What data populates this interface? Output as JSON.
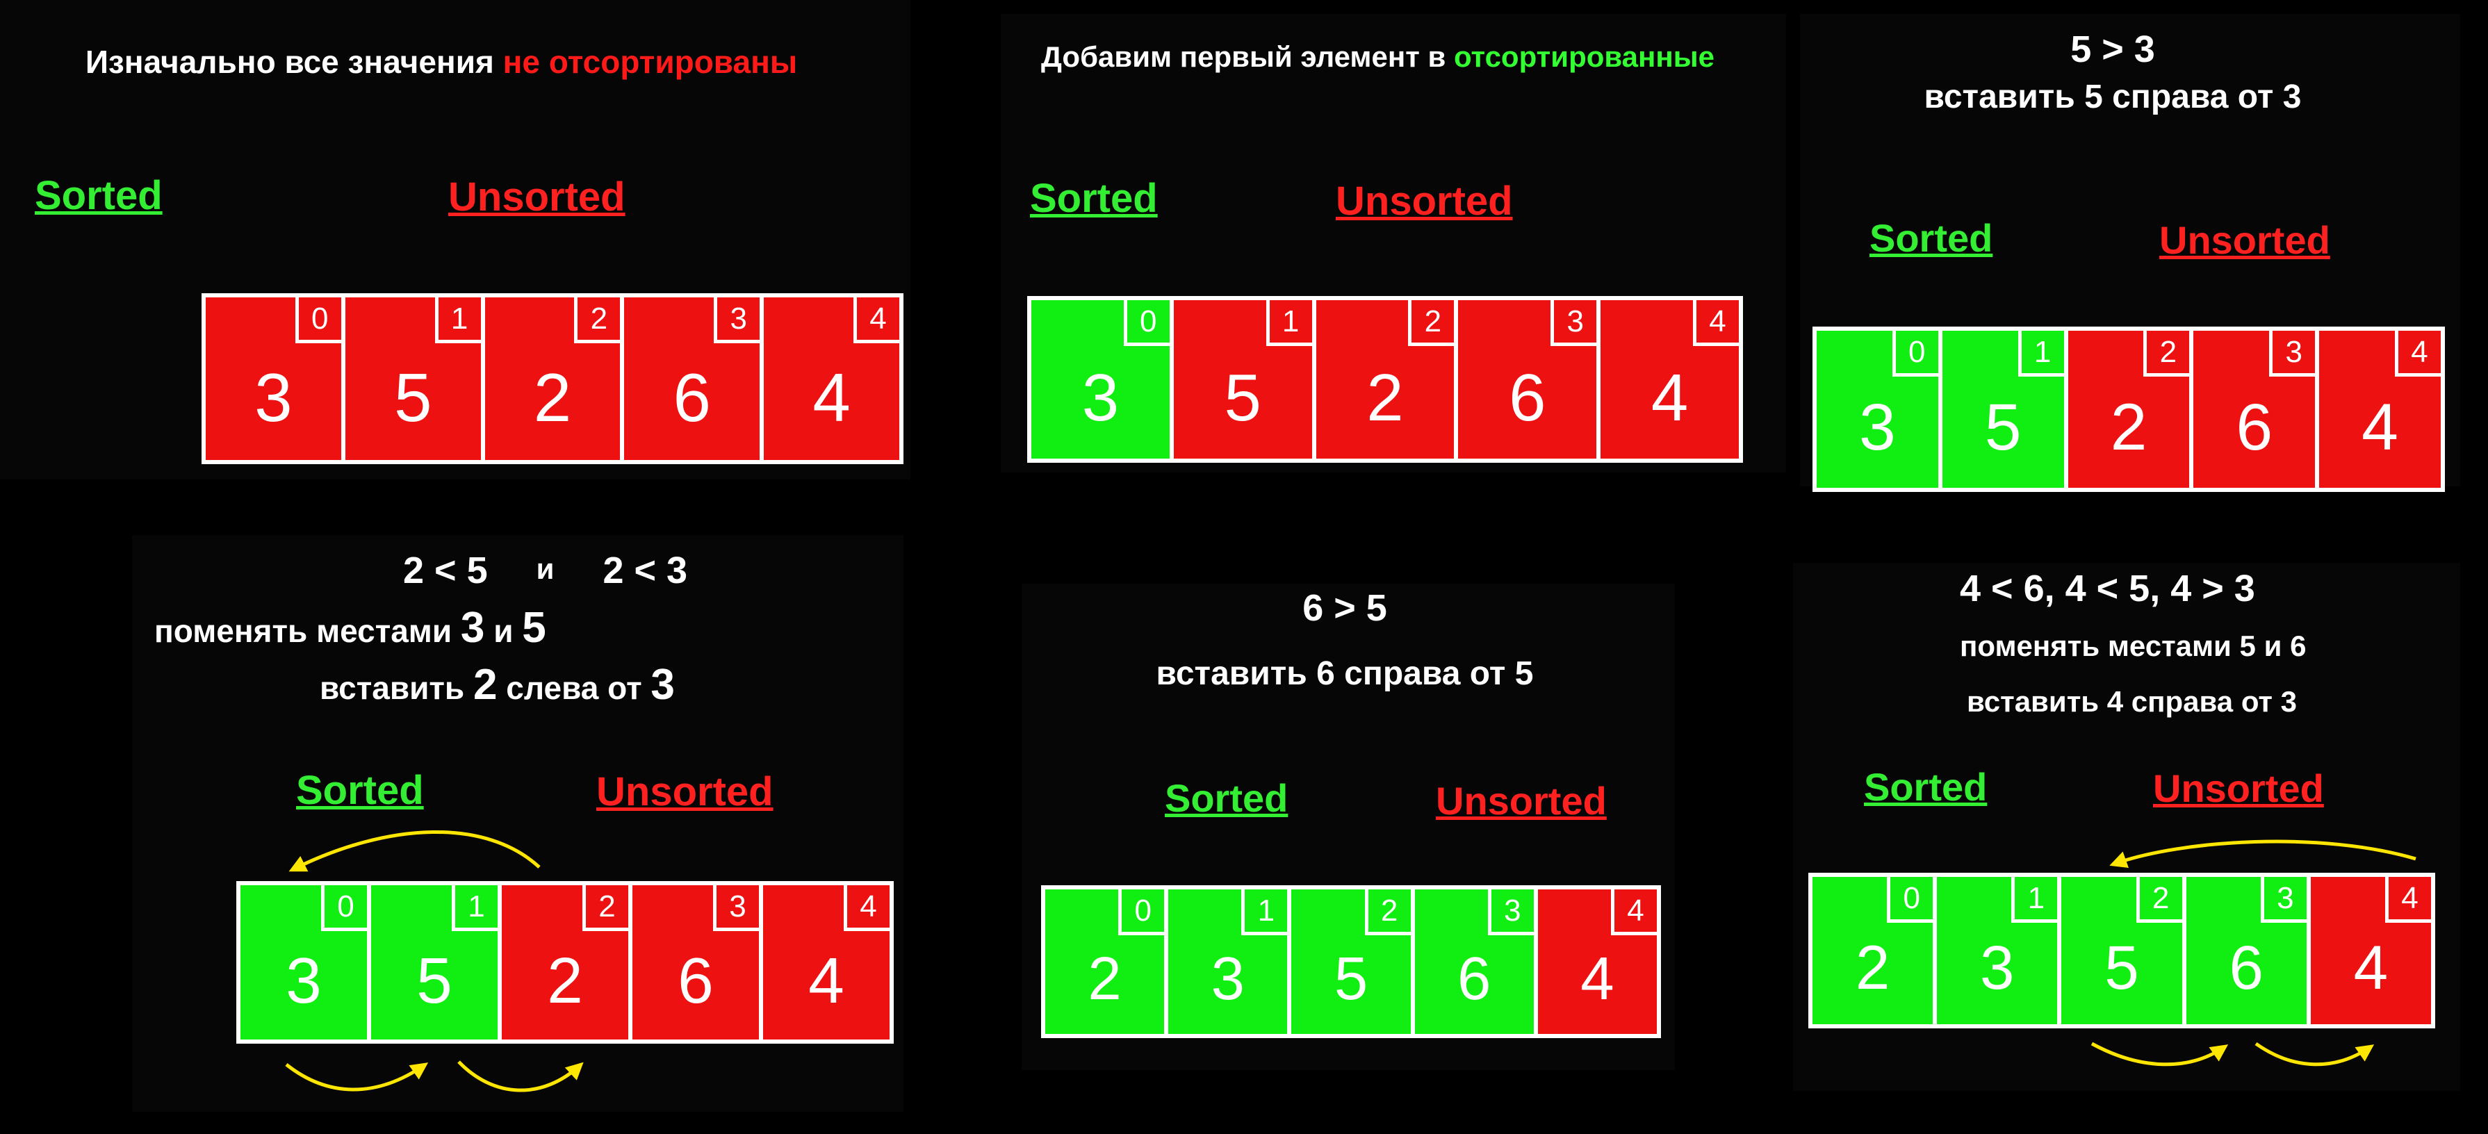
{
  "colors": {
    "sorted": "#11ee11",
    "unsorted": "#ee1111",
    "arrow": "#ffe600",
    "background": "#000000"
  },
  "labels": {
    "sorted": "Sorted",
    "unsorted": "Unsorted"
  },
  "panel1": {
    "caption_white": "Изначально все значения ",
    "caption_red": "не отсортированы",
    "cells": [
      {
        "value": "3",
        "index": "0",
        "state": "unsorted"
      },
      {
        "value": "5",
        "index": "1",
        "state": "unsorted"
      },
      {
        "value": "2",
        "index": "2",
        "state": "unsorted"
      },
      {
        "value": "6",
        "index": "3",
        "state": "unsorted"
      },
      {
        "value": "4",
        "index": "4",
        "state": "unsorted"
      }
    ]
  },
  "panel2": {
    "caption_white": "Добавим первый элемент в ",
    "caption_green": "отсортированные",
    "cells": [
      {
        "value": "3",
        "index": "0",
        "state": "sorted"
      },
      {
        "value": "5",
        "index": "1",
        "state": "unsorted"
      },
      {
        "value": "2",
        "index": "2",
        "state": "unsorted"
      },
      {
        "value": "6",
        "index": "3",
        "state": "unsorted"
      },
      {
        "value": "4",
        "index": "4",
        "state": "unsorted"
      }
    ]
  },
  "panel3": {
    "line1": "5 > 3",
    "line2": "вставить 5 справа от 3",
    "cells": [
      {
        "value": "3",
        "index": "0",
        "state": "sorted"
      },
      {
        "value": "5",
        "index": "1",
        "state": "sorted"
      },
      {
        "value": "2",
        "index": "2",
        "state": "unsorted"
      },
      {
        "value": "6",
        "index": "3",
        "state": "unsorted"
      },
      {
        "value": "4",
        "index": "4",
        "state": "unsorted"
      }
    ]
  },
  "panel4": {
    "line1_a": "2 < 5",
    "line1_b": "и",
    "line1_c": "2 < 3",
    "line2_a": "поменять местами ",
    "line2_b": "3",
    "line2_c": " и ",
    "line2_d": "5",
    "line3_a": "вставить ",
    "line3_b": "2",
    "line3_c": " слева от ",
    "line3_d": "3",
    "cells": [
      {
        "value": "3",
        "index": "0",
        "state": "sorted"
      },
      {
        "value": "5",
        "index": "1",
        "state": "sorted"
      },
      {
        "value": "2",
        "index": "2",
        "state": "unsorted"
      },
      {
        "value": "6",
        "index": "3",
        "state": "unsorted"
      },
      {
        "value": "4",
        "index": "4",
        "state": "unsorted"
      }
    ]
  },
  "panel5": {
    "line1": "6 > 5",
    "line2": "вставить 6 справа от 5",
    "cells": [
      {
        "value": "2",
        "index": "0",
        "state": "sorted"
      },
      {
        "value": "3",
        "index": "1",
        "state": "sorted"
      },
      {
        "value": "5",
        "index": "2",
        "state": "sorted"
      },
      {
        "value": "6",
        "index": "3",
        "state": "sorted"
      },
      {
        "value": "4",
        "index": "4",
        "state": "unsorted"
      }
    ]
  },
  "panel6": {
    "line1": "4 < 6, 4 < 5,  4 > 3",
    "line2": "поменять местами 5 и 6",
    "line3": "вставить 4 справа от 3",
    "cells": [
      {
        "value": "2",
        "index": "0",
        "state": "sorted"
      },
      {
        "value": "3",
        "index": "1",
        "state": "sorted"
      },
      {
        "value": "5",
        "index": "2",
        "state": "sorted"
      },
      {
        "value": "6",
        "index": "3",
        "state": "sorted"
      },
      {
        "value": "4",
        "index": "4",
        "state": "unsorted"
      }
    ]
  }
}
